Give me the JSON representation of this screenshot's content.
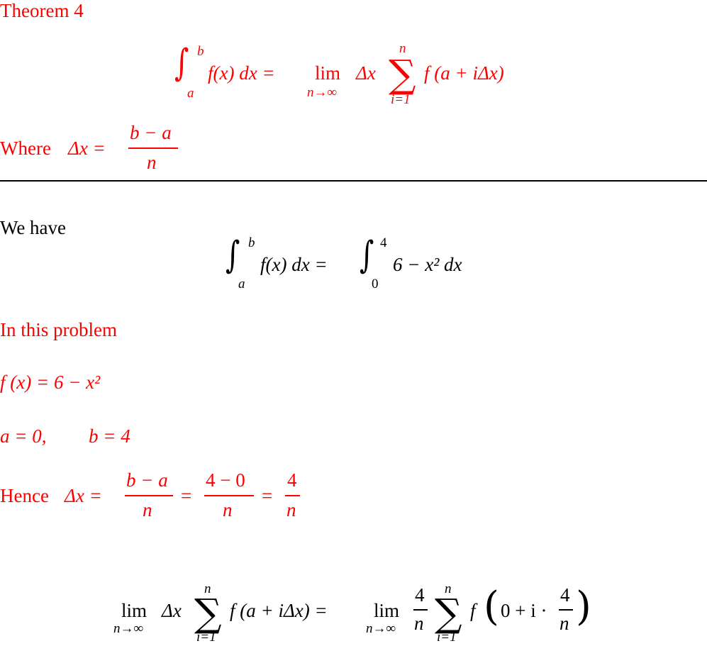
{
  "theorem": {
    "title": "Theorem 4",
    "formula": {
      "integral_upper": "b",
      "integral_lower": "a",
      "integrand": "f(x) dx =",
      "lim_word": "lim",
      "lim_under": "n→∞",
      "delta_x": "Δx",
      "sum_upper": "n",
      "sum_lower": "i=1",
      "summand": "f (a + iΔx)"
    },
    "where_label": "Where",
    "where_lhs": "Δx =",
    "where_num": "b − a",
    "where_den": "n"
  },
  "solution": {
    "we_have": "We have",
    "integral": {
      "lhs_upper": "b",
      "lhs_lower": "a",
      "lhs_integrand": "f(x) dx =",
      "rhs_upper": "4",
      "rhs_lower": "0",
      "rhs_integrand": "6 − x² dx"
    },
    "in_this_problem": "In this problem",
    "fx_def": "f (x) = 6 − x²",
    "a_def": "a = 0,",
    "b_def": "b = 4",
    "hence_label": "Hence",
    "hence_lhs": "Δx =",
    "hence_frac1_num": "b − a",
    "hence_frac1_den": "n",
    "hence_eq": "=",
    "hence_frac2_num": "4 − 0",
    "hence_frac2_den": "n",
    "hence_frac3_num": "4",
    "hence_frac3_den": "n",
    "final": {
      "lim_word": "lim",
      "lim_under": "n→∞",
      "delta_x": "Δx",
      "sum_upper": "n",
      "sum_lower": "i=1",
      "summand": "f (a + iΔx) =",
      "lim2_word": "lim",
      "lim2_under": "n→∞",
      "coef_num": "4",
      "coef_den": "n",
      "sum2_upper": "n",
      "sum2_lower": "i=1",
      "f_label": "f",
      "inner": "0 + i ·",
      "inner_num": "4",
      "inner_den": "n"
    }
  },
  "colors": {
    "highlight": "#ff0000",
    "text": "#000000"
  }
}
